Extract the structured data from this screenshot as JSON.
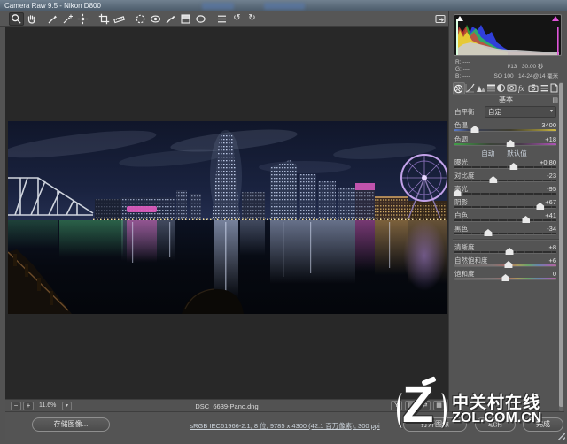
{
  "window": {
    "title": "Camera Raw 9.5 - Nikon D800"
  },
  "toolbar": {
    "tool_icons": [
      "zoom",
      "hand",
      "white-balance-eyedropper",
      "color-sampler",
      "targeted-adjustment",
      "crop",
      "straighten",
      "spot-removal",
      "red-eye",
      "adjustment-brush",
      "graduated-filter",
      "radial-filter",
      "preferences",
      "rotate-left",
      "rotate-right"
    ],
    "rotate_left_glyph": "↺",
    "rotate_right_glyph": "↻"
  },
  "histogram": {
    "rgb_r": "R: ----",
    "rgb_g": "G: ----",
    "rgb_b": "B: ----",
    "exif_line1": "f/13   30.00 秒",
    "exif_line2": "ISO 100   14-24@14 毫米"
  },
  "panel": {
    "tab_icons": [
      "basic",
      "tone-curve",
      "detail",
      "hsl-grayscale",
      "split-toning",
      "lens-corrections",
      "effects",
      "camera-calibration",
      "presets",
      "snapshots"
    ],
    "header": "基本",
    "panel_menu_glyph": "▤",
    "white_balance_label": "白平衡",
    "white_balance_value": "自定",
    "dropdown_chevron": "▾",
    "auto_link": "自动",
    "default_link": "默认值",
    "sliders": [
      {
        "label": "色温",
        "value": "3400",
        "pos": 20
      },
      {
        "label": "色调",
        "value": "+18",
        "pos": 55
      },
      {
        "label": "曝光",
        "value": "+0.80",
        "pos": 58
      },
      {
        "label": "对比度",
        "value": "-23",
        "pos": 38
      },
      {
        "label": "高光",
        "value": "-95",
        "pos": 3
      },
      {
        "label": "阴影",
        "value": "+67",
        "pos": 84
      },
      {
        "label": "白色",
        "value": "+41",
        "pos": 70
      },
      {
        "label": "黑色",
        "value": "-34",
        "pos": 33
      },
      {
        "label": "清晰度",
        "value": "+8",
        "pos": 54
      },
      {
        "label": "自然饱和度",
        "value": "+6",
        "pos": 53
      },
      {
        "label": "饱和度",
        "value": "0",
        "pos": 50
      }
    ]
  },
  "preview": {
    "zoom_out_label": "−",
    "zoom_in_label": "+",
    "zoom_level": "11.6%",
    "filename": "DSC_6639-Pano.dng",
    "view_toggles": [
      "Y",
      "▤",
      "⇄",
      "▦"
    ]
  },
  "footer": {
    "save_button": "存储图像...",
    "workflow_link": "sRGB IEC61966-2.1; 8 位; 9785 x 4300 (42.1 百万像素); 300 ppi",
    "open_button": "打开图像",
    "cancel_button": "取消",
    "done_button": "完成"
  },
  "watermark": {
    "logo_letter": "Z",
    "site_name": "中关村在线",
    "site_url": "ZOL.COM.CN"
  },
  "colors": {
    "panel_bg": "#545454",
    "preview_bg": "#282828",
    "window_border_blue": "#2b7cd0",
    "shadow_clip_indicator": "#ffffff",
    "highlight_clip_indicator": "#e055d8"
  }
}
